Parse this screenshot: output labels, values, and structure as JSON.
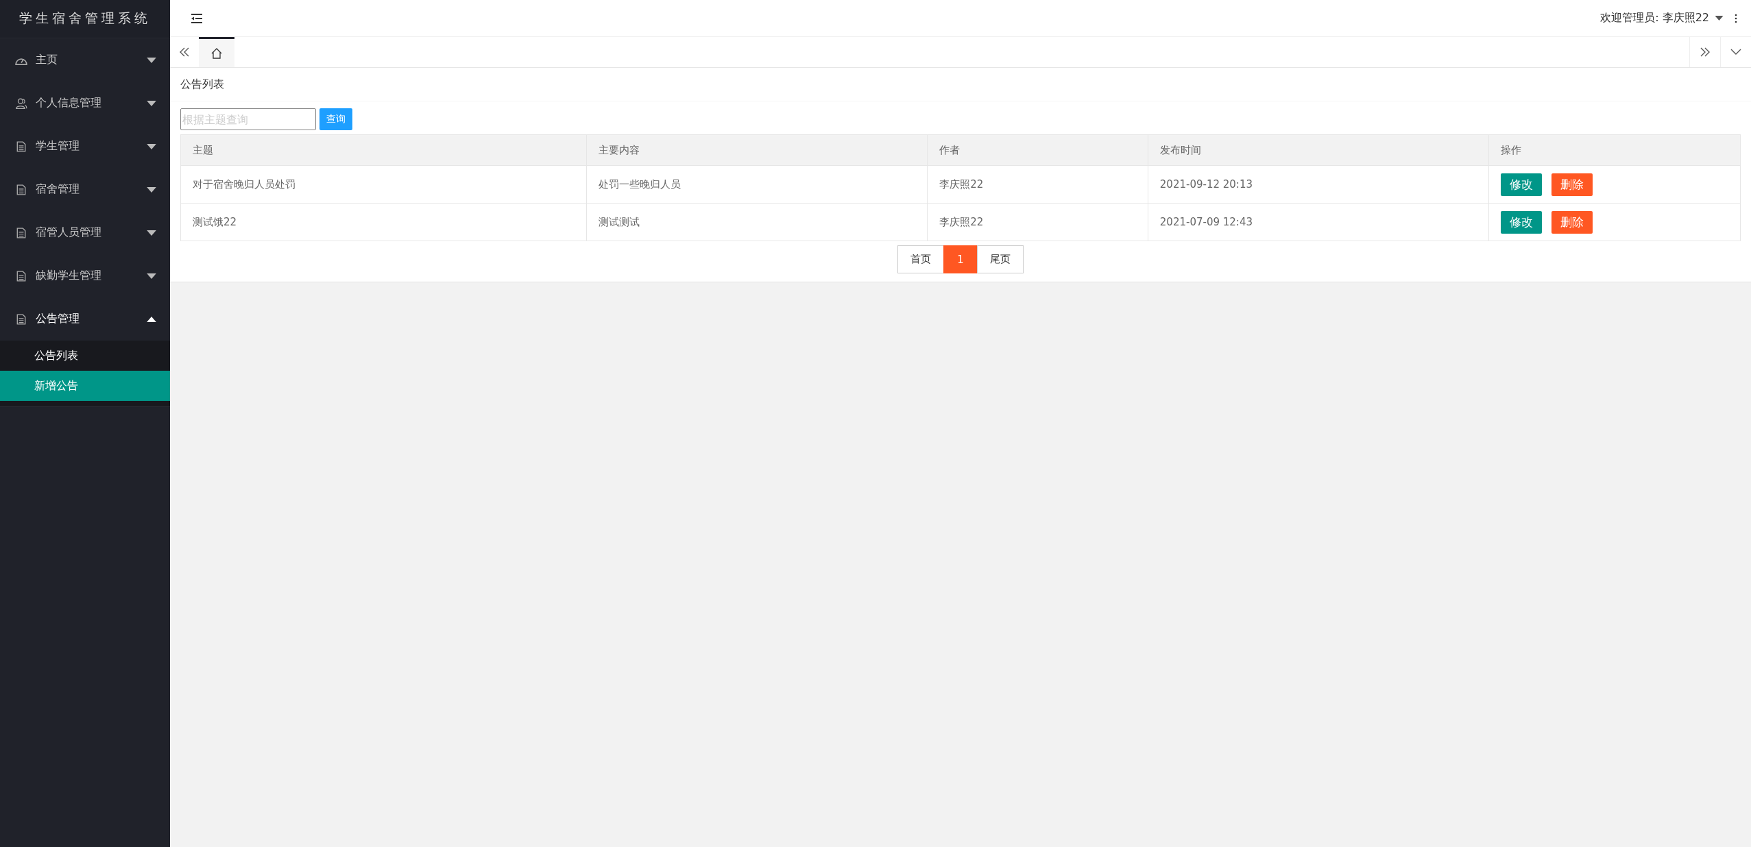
{
  "sidebar": {
    "title": "学生宿舍管理系统",
    "items": [
      {
        "label": "主页",
        "kind": "gauge",
        "expanded": false
      },
      {
        "label": "个人信息管理",
        "kind": "person",
        "expanded": false
      },
      {
        "label": "学生管理",
        "kind": "document",
        "expanded": false
      },
      {
        "label": "宿舍管理",
        "kind": "document",
        "expanded": false
      },
      {
        "label": "宿管人员管理",
        "kind": "document",
        "expanded": false
      },
      {
        "label": "缺勤学生管理",
        "kind": "document",
        "expanded": false
      },
      {
        "label": "公告管理",
        "kind": "document",
        "expanded": true,
        "children": [
          {
            "label": "公告列表",
            "selected": false
          },
          {
            "label": "新增公告",
            "selected": true
          }
        ]
      }
    ]
  },
  "header": {
    "user": "欢迎管理员: 李庆照22"
  },
  "tabs": [
    {
      "kind": "home",
      "selected": true
    }
  ],
  "page_title": "公告列表",
  "search": {
    "placeholder": "根据主题查询",
    "button": "查询"
  },
  "table": {
    "columns": [
      "主题",
      "主要内容",
      "作者",
      "发布时间",
      "操作"
    ],
    "rows": [
      {
        "cells": [
          "对于宿舍晚归人员处罚",
          "处罚一些晚归人员",
          "李庆照22",
          "2021-09-12 20:13"
        ],
        "actions": [
          "修改",
          "删除"
        ]
      },
      {
        "cells": [
          "测试饿22",
          "测试测试",
          "李庆照22",
          "2021-07-09 12:43"
        ],
        "actions": [
          "修改",
          "删除"
        ]
      }
    ]
  },
  "pagination": [
    {
      "label": "首页",
      "selected": false
    },
    {
      "label": "1",
      "selected": true
    },
    {
      "label": "尾页",
      "selected": false
    }
  ]
}
